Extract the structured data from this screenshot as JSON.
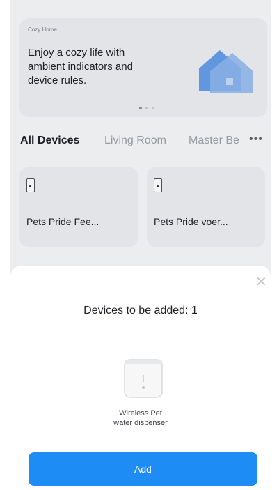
{
  "banner": {
    "small_title": "Cozy Home",
    "text": "Enjoy a cozy life with ambient indicators and device rules.",
    "illustration": "house-icon"
  },
  "tabs": [
    {
      "label": "All Devices",
      "active": true
    },
    {
      "label": "Living Room",
      "active": false
    },
    {
      "label": "Master Be",
      "active": false
    }
  ],
  "more_label": "•••",
  "devices": [
    {
      "label": "Pets Pride Fee...",
      "icon": "feeder-icon"
    },
    {
      "label": "Pets Pride voer...",
      "icon": "feeder-icon"
    }
  ],
  "sheet": {
    "close_icon": "close-icon",
    "title": "Devices to be added: 1",
    "product_name_line1": "Wireless Pet",
    "product_name_line2": "water dispenser",
    "add_label": "Add"
  },
  "colors": {
    "accent": "#1e8cf5",
    "background": "#f6f7f9",
    "card": "#eceef2"
  }
}
